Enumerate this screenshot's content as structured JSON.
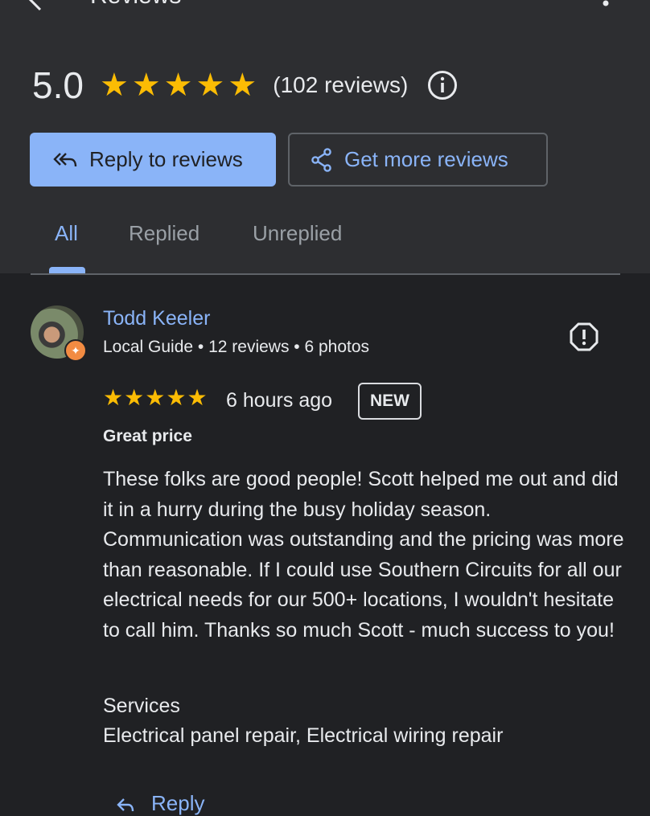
{
  "appbar": {
    "title": "Reviews",
    "back_icon": "arrow-back-icon",
    "more_icon": "more-vert-icon"
  },
  "summary": {
    "rating": "5.0",
    "stars": 5,
    "review_count": "(102 reviews)",
    "info_icon": "info-icon"
  },
  "actions": {
    "reply_label": "Reply to reviews",
    "get_more_label": "Get more reviews",
    "reply_icon": "reply-all-icon",
    "share_icon": "share-icon"
  },
  "tabs": [
    {
      "label": "All",
      "selected": true
    },
    {
      "label": "Replied",
      "selected": false
    },
    {
      "label": "Unreplied",
      "selected": false
    }
  ],
  "review": {
    "reviewer_name": "Todd Keeler",
    "reviewer_meta": "Local Guide • 12 reviews • 6 photos",
    "stars": 5,
    "time": "6 hours ago",
    "badge": "NEW",
    "title": "Great price",
    "body": "These folks are good people! Scott helped me out and did it in a hurry during the busy holiday season. Communication was outstanding and the pricing was more than reasonable. If I could use Southern Circuits for all our electrical needs for our 500+ locations, I wouldn't hesitate to call him. Thanks so much Scott - much success to you!",
    "services_label": "Services",
    "services_value": "Electrical panel repair, Electrical wiring repair",
    "reply_label": "Reply"
  },
  "colors": {
    "accent": "#8ab4f8",
    "star": "#fbbc04",
    "background": "#202124",
    "header_background": "#2d2e31"
  }
}
